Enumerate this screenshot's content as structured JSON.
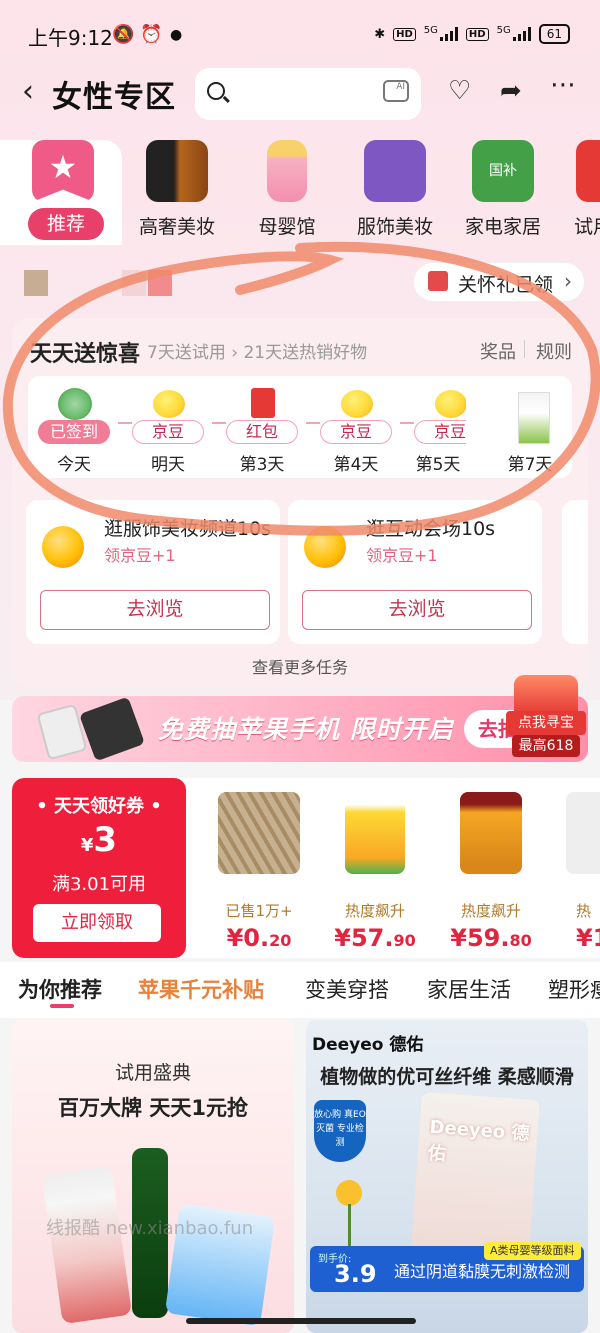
{
  "status_bar": {
    "time": "上午9:12",
    "icons": [
      "bell-mute-icon",
      "alarm-icon",
      "dot-icon",
      "bluetooth-icon",
      "hd-icon",
      "signal-5g-icon",
      "hd-icon",
      "signal-5g-icon"
    ],
    "net_label_1": "5G",
    "net_label_2": "5G",
    "hd_label": "HD",
    "battery": "61"
  },
  "header": {
    "back_icon": "‹",
    "title": "女性专区",
    "search_placeholder": "",
    "camera_label": "AI",
    "icons": [
      "heart-plus-icon",
      "share-icon",
      "more-icon"
    ]
  },
  "categories": [
    {
      "label": "推荐",
      "icon": "star-ribbon-icon",
      "active": true
    },
    {
      "label": "高奢美妆",
      "icon": "luxury-cosmetics-icon"
    },
    {
      "label": "母婴馆",
      "icon": "baby-bottle-icon"
    },
    {
      "label": "服饰美妆",
      "icon": "clothing-icon"
    },
    {
      "label": "家电家居",
      "icon": "appliance-icon",
      "badge": "国补"
    },
    {
      "label": "试用",
      "icon": "trial-icon"
    }
  ],
  "gift_chip": {
    "label": "关怀礼已领",
    "arrow": "›"
  },
  "daily": {
    "title": "天天送惊喜",
    "subtitle_a": "7天送试用",
    "subtitle_sep": "›",
    "subtitle_b": "21天送热销好物",
    "link_prizes": "奖品",
    "link_rules": "规则",
    "days": [
      {
        "tag": "已签到",
        "label": "今天",
        "icon": "cabbage-icon",
        "done": true
      },
      {
        "tag": "京豆",
        "label": "明天",
        "icon": "bean-coin-icon"
      },
      {
        "tag": "红包",
        "label": "第3天",
        "icon": "red-packet-icon"
      },
      {
        "tag": "京豆",
        "label": "第4天",
        "icon": "bean-coin-icon"
      },
      {
        "tag": "京豆",
        "label": "第5天",
        "icon": "bean-coin-icon"
      },
      {
        "tag": "",
        "label": "第7天",
        "icon": "trial-pack-icon"
      }
    ],
    "tasks": [
      {
        "title": "逛服饰美妆频道10s",
        "reward": "领京豆+1",
        "button": "去浏览"
      },
      {
        "title": "逛互动会场10s",
        "reward": "领京豆+1",
        "button": "去浏览"
      }
    ],
    "more": "查看更多任务"
  },
  "banner": {
    "text": "免费抽苹果手机 限时开启",
    "button": "去抽",
    "treasure_line1": "点我寻宝",
    "treasure_line2": "最高618"
  },
  "coupon": {
    "title": "• 天天领好券 •",
    "currency": "¥",
    "amount": "3",
    "condition": "满3.01可用",
    "button": "立即领取"
  },
  "products": [
    {
      "label": "已售1万+",
      "price_main": "¥0.",
      "price_dec": "20",
      "image": "rope-product"
    },
    {
      "label": "热度飙升",
      "price_main": "¥57.",
      "price_dec": "90",
      "image": "corn-oil-product"
    },
    {
      "label": "热度飙升",
      "price_main": "¥59.",
      "price_dec": "80",
      "image": "cooking-oil-product"
    },
    {
      "label": "热",
      "price_main": "¥1",
      "price_dec": "",
      "image": "partial-product"
    }
  ],
  "tabs": [
    {
      "label": "为你推荐",
      "active": true
    },
    {
      "label": "苹果千元补贴",
      "promo": true
    },
    {
      "label": "变美穿搭"
    },
    {
      "label": "家居生活"
    },
    {
      "label": "塑形瘦"
    }
  ],
  "feed": {
    "left": {
      "line1": "试用盛典",
      "line2": "百万大牌 天天1元抢"
    },
    "right": {
      "brand": "Deeyeo 德佑",
      "title": "植物做的优可丝纤维 柔感顺滑",
      "shield": "放心购 真EO灭菌 专业检测",
      "pack": "Deeyeo 德佑",
      "price_label": "到手价:",
      "price": "3.9",
      "desc": "通过阴道黏膜无刺激检测",
      "grade": "A类母婴等级面料"
    }
  },
  "watermark": "线报酷 new.xianbao.fun",
  "colors": {
    "accent": "#e8406a",
    "coupon_red": "#ef1f3b",
    "promo_orange": "#e8813a",
    "scribble": "#f08a6a"
  }
}
